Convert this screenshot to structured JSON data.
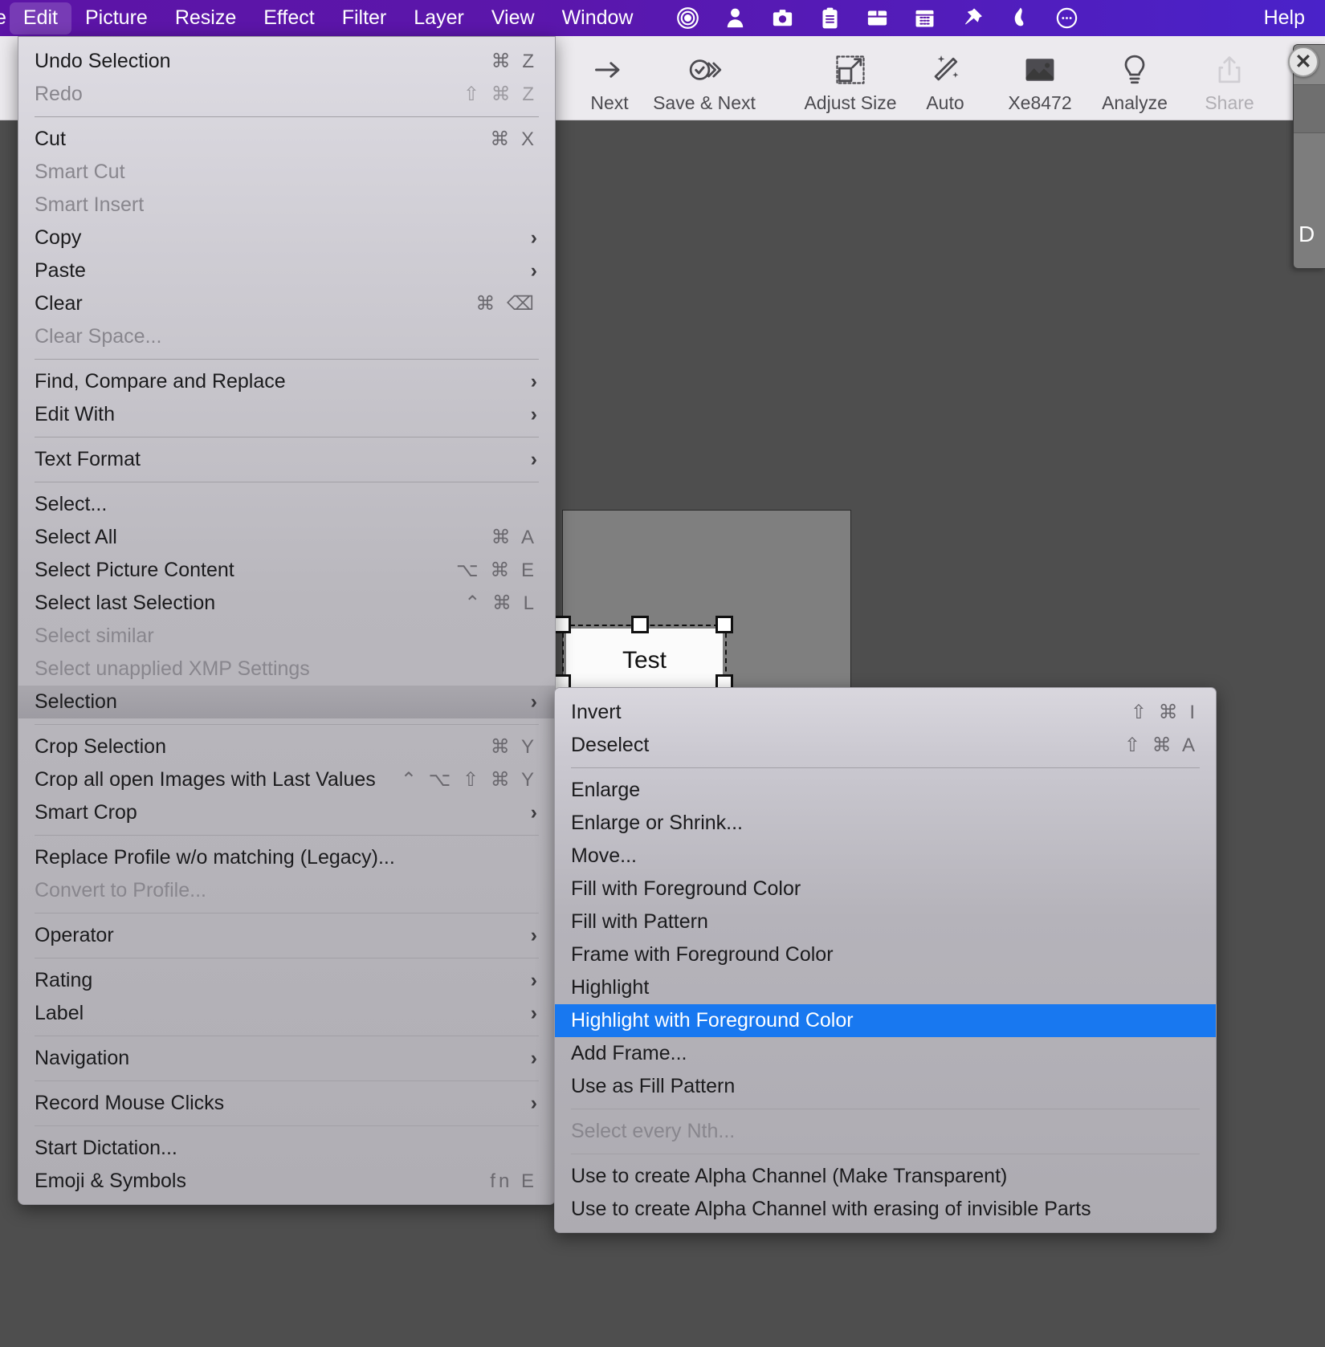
{
  "menubar": {
    "items": [
      {
        "label": "e",
        "active": false,
        "clipped": true
      },
      {
        "label": "Edit",
        "active": true
      },
      {
        "label": "Picture",
        "active": false
      },
      {
        "label": "Resize",
        "active": false
      },
      {
        "label": "Effect",
        "active": false
      },
      {
        "label": "Filter",
        "active": false
      },
      {
        "label": "Layer",
        "active": false
      },
      {
        "label": "View",
        "active": false
      },
      {
        "label": "Window",
        "active": false
      }
    ],
    "icons": [
      "target-icon",
      "person-icon",
      "camera-icon",
      "clipboard-icon",
      "box-icon",
      "calendar-icon",
      "pin-icon",
      "flame-icon",
      "ellipsis-circle-icon"
    ],
    "help_label": "Help"
  },
  "toolbar": {
    "items": [
      {
        "label": "Next",
        "icon": "arrow-right-icon",
        "disabled": false
      },
      {
        "label": "Save & Next",
        "icon": "save-next-icon",
        "disabled": false
      },
      {
        "label": "Adjust Size",
        "icon": "adjust-size-icon",
        "disabled": false
      },
      {
        "label": "Auto",
        "icon": "magic-wand-icon",
        "disabled": false
      },
      {
        "label": "Xe8472",
        "icon": "picture-icon",
        "disabled": false
      },
      {
        "label": "Analyze",
        "icon": "lightbulb-icon",
        "disabled": false
      },
      {
        "label": "Share",
        "icon": "share-icon",
        "disabled": true
      }
    ]
  },
  "canvas": {
    "text_layer_value": "Test",
    "right_panel_letter": "D",
    "close_label": "✕"
  },
  "edit_menu": {
    "title": "Edit",
    "groups": [
      {
        "items": [
          {
            "label": "Undo Selection",
            "shortcut": "⌘ Z",
            "disabled": false,
            "submenu": false
          },
          {
            "label": "Redo",
            "shortcut": "⇧ ⌘ Z",
            "disabled": true,
            "submenu": false
          }
        ]
      },
      {
        "items": [
          {
            "label": "Cut",
            "shortcut": "⌘ X",
            "disabled": false,
            "submenu": false
          },
          {
            "label": "Smart Cut",
            "shortcut": "",
            "disabled": true,
            "submenu": false
          },
          {
            "label": "Smart Insert",
            "shortcut": "",
            "disabled": true,
            "submenu": false
          },
          {
            "label": "Copy",
            "shortcut": "",
            "disabled": false,
            "submenu": true
          },
          {
            "label": "Paste",
            "shortcut": "",
            "disabled": false,
            "submenu": true
          },
          {
            "label": "Clear",
            "shortcut": "⌘ ⌫",
            "disabled": false,
            "submenu": false
          },
          {
            "label": "Clear Space...",
            "shortcut": "",
            "disabled": true,
            "submenu": false
          }
        ]
      },
      {
        "items": [
          {
            "label": "Find, Compare and Replace",
            "shortcut": "",
            "disabled": false,
            "submenu": true
          },
          {
            "label": "Edit With",
            "shortcut": "",
            "disabled": false,
            "submenu": true
          }
        ]
      },
      {
        "items": [
          {
            "label": "Text Format",
            "shortcut": "",
            "disabled": false,
            "submenu": true
          }
        ]
      },
      {
        "items": [
          {
            "label": "Select...",
            "shortcut": "",
            "disabled": false,
            "submenu": false
          },
          {
            "label": "Select All",
            "shortcut": "⌘ A",
            "disabled": false,
            "submenu": false
          },
          {
            "label": "Select Picture Content",
            "shortcut": "⌥ ⌘ E",
            "disabled": false,
            "submenu": false
          },
          {
            "label": "Select last Selection",
            "shortcut": "⌃ ⌘ L",
            "disabled": false,
            "submenu": false
          },
          {
            "label": "Select similar",
            "shortcut": "",
            "disabled": true,
            "submenu": false
          },
          {
            "label": "Select unapplied XMP Settings",
            "shortcut": "",
            "disabled": true,
            "submenu": false
          },
          {
            "label": "Selection",
            "shortcut": "",
            "disabled": false,
            "submenu": true,
            "highlighted": true
          }
        ]
      },
      {
        "items": [
          {
            "label": "Crop Selection",
            "shortcut": "⌘ Y",
            "disabled": false,
            "submenu": false
          },
          {
            "label": "Crop all open Images with Last Values",
            "shortcut": "⌃ ⌥ ⇧ ⌘ Y",
            "disabled": false,
            "submenu": false
          },
          {
            "label": "Smart Crop",
            "shortcut": "",
            "disabled": false,
            "submenu": true
          }
        ]
      },
      {
        "items": [
          {
            "label": "Replace Profile w/o matching (Legacy)...",
            "shortcut": "",
            "disabled": false,
            "submenu": false
          },
          {
            "label": "Convert to Profile...",
            "shortcut": "",
            "disabled": true,
            "submenu": false
          }
        ]
      },
      {
        "items": [
          {
            "label": "Operator",
            "shortcut": "",
            "disabled": false,
            "submenu": true
          }
        ]
      },
      {
        "items": [
          {
            "label": "Rating",
            "shortcut": "",
            "disabled": false,
            "submenu": true
          },
          {
            "label": "Label",
            "shortcut": "",
            "disabled": false,
            "submenu": true
          }
        ]
      },
      {
        "items": [
          {
            "label": "Navigation",
            "shortcut": "",
            "disabled": false,
            "submenu": true
          }
        ]
      },
      {
        "items": [
          {
            "label": "Record Mouse Clicks",
            "shortcut": "",
            "disabled": false,
            "submenu": true
          }
        ]
      },
      {
        "items": [
          {
            "label": "Start Dictation...",
            "shortcut": "",
            "disabled": false,
            "submenu": false
          },
          {
            "label": "Emoji & Symbols",
            "shortcut": "fn E",
            "disabled": false,
            "submenu": false
          }
        ]
      }
    ]
  },
  "selection_submenu": {
    "title": "Selection",
    "groups": [
      {
        "items": [
          {
            "label": "Invert",
            "shortcut": "⇧ ⌘ I",
            "disabled": false
          },
          {
            "label": "Deselect",
            "shortcut": "⇧ ⌘ A",
            "disabled": false
          }
        ]
      },
      {
        "items": [
          {
            "label": "Enlarge",
            "shortcut": "",
            "disabled": false
          },
          {
            "label": "Enlarge or Shrink...",
            "shortcut": "",
            "disabled": false
          },
          {
            "label": "Move...",
            "shortcut": "",
            "disabled": false
          },
          {
            "label": "Fill with Foreground Color",
            "shortcut": "",
            "disabled": false
          },
          {
            "label": "Fill with Pattern",
            "shortcut": "",
            "disabled": false
          },
          {
            "label": "Frame with Foreground Color",
            "shortcut": "",
            "disabled": false
          },
          {
            "label": "Highlight",
            "shortcut": "",
            "disabled": false
          },
          {
            "label": "Highlight with Foreground Color",
            "shortcut": "",
            "disabled": false,
            "highlighted": true
          },
          {
            "label": "Add Frame...",
            "shortcut": "",
            "disabled": false
          },
          {
            "label": "Use as Fill Pattern",
            "shortcut": "",
            "disabled": false
          }
        ]
      },
      {
        "items": [
          {
            "label": "Select every Nth...",
            "shortcut": "",
            "disabled": true
          }
        ]
      },
      {
        "items": [
          {
            "label": "Use to create Alpha Channel (Make Transparent)",
            "shortcut": "",
            "disabled": false
          },
          {
            "label": "Use to create Alpha Channel with erasing of invisible Parts",
            "shortcut": "",
            "disabled": false
          }
        ]
      }
    ]
  },
  "colors": {
    "menubar_start": "#5c14a6",
    "menubar_end": "#4a22c9",
    "highlight_blue": "#1878f0",
    "toolbar_bg": "#eceaee",
    "canvas_bg": "#4e4e4e"
  }
}
